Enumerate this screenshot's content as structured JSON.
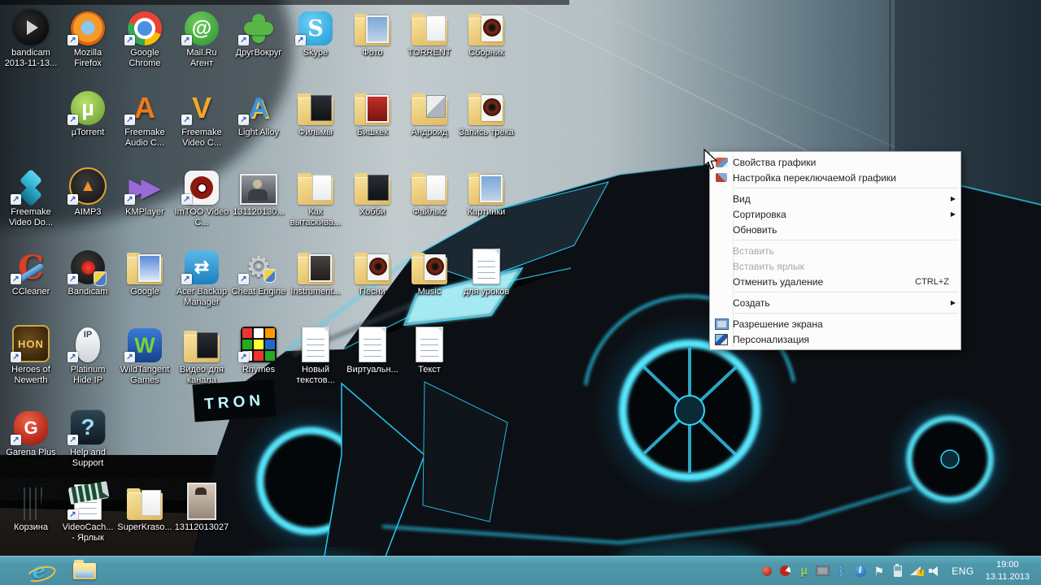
{
  "wallpaper": {
    "tron_text": "TRON",
    "accent_color": "#2bd8ff"
  },
  "desktop": {
    "icons": [
      {
        "name": "bandicam-recording",
        "label": "bandicam 2013-11-13...",
        "icon": "bandicam-file",
        "col": 0,
        "row": 0,
        "shortcut": false
      },
      {
        "name": "mozilla-firefox",
        "label": "Mozilla Firefox",
        "icon": "firefox",
        "col": 1,
        "row": 0,
        "shortcut": true
      },
      {
        "name": "google-chrome",
        "label": "Google Chrome",
        "icon": "chrome",
        "col": 2,
        "row": 0,
        "shortcut": true
      },
      {
        "name": "mailru-agent",
        "label": "Mail.Ru Агент",
        "icon": "mailru",
        "col": 3,
        "row": 0,
        "shortcut": true
      },
      {
        "name": "drugvokrug",
        "label": "ДругВокруг",
        "icon": "drugvokrug",
        "col": 4,
        "row": 0,
        "shortcut": true
      },
      {
        "name": "skype",
        "label": "Skype",
        "icon": "skype",
        "col": 5,
        "row": 0,
        "shortcut": true
      },
      {
        "name": "photo-folder",
        "label": "Фото",
        "icon": "folder-photo",
        "col": 6,
        "row": 0,
        "shortcut": false
      },
      {
        "name": "torrent-folder",
        "label": "TORRENT",
        "icon": "folder-paper",
        "col": 7,
        "row": 0,
        "shortcut": false
      },
      {
        "name": "sbornik-folder",
        "label": "Сборник",
        "icon": "folder-disc",
        "col": 8,
        "row": 0,
        "shortcut": false
      },
      {
        "name": "utorrent",
        "label": "µTorrent",
        "icon": "utorrent",
        "col": 1,
        "row": 1,
        "shortcut": true
      },
      {
        "name": "freemake-audio-converter",
        "label": "Freemake Audio C...",
        "icon": "freemake-audio",
        "col": 2,
        "row": 1,
        "shortcut": true
      },
      {
        "name": "freemake-video-converter",
        "label": "Freemake Video C...",
        "icon": "freemake-video",
        "col": 3,
        "row": 1,
        "shortcut": true
      },
      {
        "name": "light-alloy",
        "label": "Light Alloy",
        "icon": "light-alloy",
        "col": 4,
        "row": 1,
        "shortcut": true
      },
      {
        "name": "films-folder",
        "label": "Фильмы",
        "icon": "folder-dark",
        "col": 5,
        "row": 1,
        "shortcut": false
      },
      {
        "name": "bishkek-folder",
        "label": "Бишкек",
        "icon": "folder-photo-red",
        "col": 6,
        "row": 1,
        "shortcut": false
      },
      {
        "name": "android-folder",
        "label": "Андроид",
        "icon": "folder-cube",
        "col": 7,
        "row": 1,
        "shortcut": false
      },
      {
        "name": "track-recording-folder",
        "label": "Запись трека",
        "icon": "folder-disc",
        "col": 8,
        "row": 1,
        "shortcut": false
      },
      {
        "name": "freemake-video-downloader",
        "label": "Freemake Video Do...",
        "icon": "fvd",
        "col": 0,
        "row": 2,
        "shortcut": true
      },
      {
        "name": "aimp3",
        "label": "AIMP3",
        "icon": "aimp",
        "col": 1,
        "row": 2,
        "shortcut": true
      },
      {
        "name": "kmplayer",
        "label": "KMPlayer",
        "icon": "kmplayer",
        "col": 2,
        "row": 2,
        "shortcut": true
      },
      {
        "name": "imtoo-video-converter",
        "label": "ImTOO Video C...",
        "icon": "imtoo",
        "col": 3,
        "row": 2,
        "shortcut": true
      },
      {
        "name": "video-131120130",
        "label": "131120130...",
        "icon": "video-thumb",
        "col": 4,
        "row": 2,
        "shortcut": false
      },
      {
        "name": "kak-vytaskivat-folder",
        "label": "Как вытаскива...",
        "icon": "folder-paper",
        "col": 5,
        "row": 2,
        "shortcut": false
      },
      {
        "name": "hobby-folder",
        "label": "Хобби",
        "icon": "folder-dark",
        "col": 6,
        "row": 2,
        "shortcut": false
      },
      {
        "name": "files2-folder",
        "label": "Файлы2",
        "icon": "folder-paper",
        "col": 7,
        "row": 2,
        "shortcut": false
      },
      {
        "name": "pictures-folder",
        "label": "Картинки",
        "icon": "folder-photo",
        "col": 8,
        "row": 2,
        "shortcut": false
      },
      {
        "name": "ccleaner",
        "label": "CCleaner",
        "icon": "ccleaner",
        "col": 0,
        "row": 3,
        "shortcut": true
      },
      {
        "name": "bandicam",
        "label": "Bandicam",
        "icon": "bandicam-app",
        "col": 1,
        "row": 3,
        "shortcut": true
      },
      {
        "name": "google-folder",
        "label": "Google",
        "icon": "folder-photo-blue",
        "col": 2,
        "row": 3,
        "shortcut": false
      },
      {
        "name": "acer-backup-manager",
        "label": "Acer Backup Manager",
        "icon": "acer",
        "col": 3,
        "row": 3,
        "shortcut": true
      },
      {
        "name": "cheat-engine",
        "label": "Cheat Engine",
        "icon": "cheat",
        "col": 4,
        "row": 3,
        "shortcut": true
      },
      {
        "name": "instrument-folder",
        "label": "Instrument...",
        "icon": "folder-photo-dark",
        "col": 5,
        "row": 3,
        "shortcut": false
      },
      {
        "name": "songs-folder",
        "label": "Песни",
        "icon": "folder-disc",
        "col": 6,
        "row": 3,
        "shortcut": false
      },
      {
        "name": "music-folder",
        "label": "Music",
        "icon": "folder-disc",
        "col": 7,
        "row": 3,
        "shortcut": false
      },
      {
        "name": "for-lessons-doc",
        "label": "для уроков",
        "icon": "doc",
        "col": 8,
        "row": 3,
        "shortcut": false
      },
      {
        "name": "heroes-of-newerth",
        "label": "Heroes of Newerth",
        "icon": "hon",
        "col": 0,
        "row": 4,
        "shortcut": true
      },
      {
        "name": "platinum-hide-ip",
        "label": "Platinum Hide IP",
        "icon": "hideip",
        "col": 1,
        "row": 4,
        "shortcut": true
      },
      {
        "name": "wildtangent-games",
        "label": "WildTangent Games",
        "icon": "wildtangent",
        "col": 2,
        "row": 4,
        "shortcut": true
      },
      {
        "name": "video-for-channel-folder",
        "label": "Видео для канала",
        "icon": "folder-dark",
        "col": 3,
        "row": 4,
        "shortcut": false
      },
      {
        "name": "rhymes",
        "label": "Rhymes",
        "icon": "rubik",
        "col": 4,
        "row": 4,
        "shortcut": true
      },
      {
        "name": "new-text-doc",
        "label": "Новый текстов...",
        "icon": "doc",
        "col": 5,
        "row": 4,
        "shortcut": false
      },
      {
        "name": "virtual-doc",
        "label": "Виртуальн...",
        "icon": "doc",
        "col": 6,
        "row": 4,
        "shortcut": false
      },
      {
        "name": "text-doc",
        "label": "Текст",
        "icon": "doc",
        "col": 7,
        "row": 4,
        "shortcut": false
      },
      {
        "name": "garena-plus",
        "label": "Garena Plus",
        "icon": "garena",
        "col": 0,
        "row": 5,
        "shortcut": true
      },
      {
        "name": "help-and-support",
        "label": "Help and Support",
        "icon": "help",
        "col": 1,
        "row": 5,
        "shortcut": true
      },
      {
        "name": "recycle-bin",
        "label": "Корзина",
        "icon": "bin",
        "col": 0,
        "row": 6,
        "shortcut": false
      },
      {
        "name": "videocach-shortcut",
        "label": "VideoCach... - Ярлык",
        "icon": "videocach",
        "col": 1,
        "row": 6,
        "shortcut": true
      },
      {
        "name": "superkraso-folder",
        "label": "SuperKraso...",
        "icon": "folder-paper",
        "col": 2,
        "row": 6,
        "shortcut": false
      },
      {
        "name": "photo-13112013027",
        "label": "13112013027",
        "icon": "photo-thumb",
        "col": 3,
        "row": 6,
        "shortcut": false
      }
    ]
  },
  "context_menu": {
    "items": [
      {
        "name": "graphics-properties",
        "label": "Свойства графики",
        "icon": "mi-graphics"
      },
      {
        "name": "switchable-graphics-settings",
        "label": "Настройка переключаемой графики",
        "icon": "mi-switchable"
      },
      {
        "type": "separator"
      },
      {
        "name": "view",
        "label": "Вид",
        "submenu": true
      },
      {
        "name": "sort-by",
        "label": "Сортировка",
        "submenu": true
      },
      {
        "name": "refresh",
        "label": "Обновить"
      },
      {
        "type": "separator"
      },
      {
        "name": "paste",
        "label": "Вставить",
        "disabled": true
      },
      {
        "name": "paste-shortcut",
        "label": "Вставить ярлык",
        "disabled": true
      },
      {
        "name": "undo-delete",
        "label": "Отменить удаление",
        "shortcut": "CTRL+Z"
      },
      {
        "type": "separator"
      },
      {
        "name": "new",
        "label": "Создать",
        "submenu": true
      },
      {
        "type": "separator"
      },
      {
        "name": "screen-resolution",
        "label": "Разрешение экрана",
        "icon": "mi-resolution"
      },
      {
        "name": "personalization",
        "label": "Персонализация",
        "icon": "mi-personalization"
      }
    ]
  },
  "taskbar": {
    "pinned": [
      {
        "name": "internet-explorer"
      },
      {
        "name": "file-explorer"
      }
    ],
    "tray": [
      {
        "name": "recorder-icon"
      },
      {
        "name": "red-app-icon"
      },
      {
        "name": "utorrent-tray-icon"
      },
      {
        "name": "display-icon"
      },
      {
        "name": "bluetooth-icon"
      },
      {
        "name": "intel-info-icon"
      },
      {
        "name": "action-center-flag-icon"
      },
      {
        "name": "battery-icon"
      },
      {
        "name": "network-warning-icon"
      },
      {
        "name": "volume-icon"
      }
    ],
    "language": "ENG",
    "time": "19:00",
    "date": "13.11.2013"
  }
}
